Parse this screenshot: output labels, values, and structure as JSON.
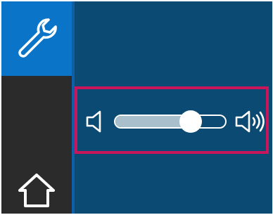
{
  "sidebar": {
    "items": [
      {
        "id": "settings",
        "icon": "wrench-icon",
        "selected": true
      },
      {
        "id": "home",
        "icon": "home-icon",
        "selected": false
      }
    ]
  },
  "volume": {
    "level": 0.68,
    "min_icon": "speaker-low-icon",
    "max_icon": "speaker-high-icon"
  },
  "colors": {
    "background": "#0a4a73",
    "sidebar": "#2b2b2b",
    "selected": "#0a74c9",
    "highlight_border": "#c8155c",
    "slider_fill": "#a9bfcc"
  }
}
